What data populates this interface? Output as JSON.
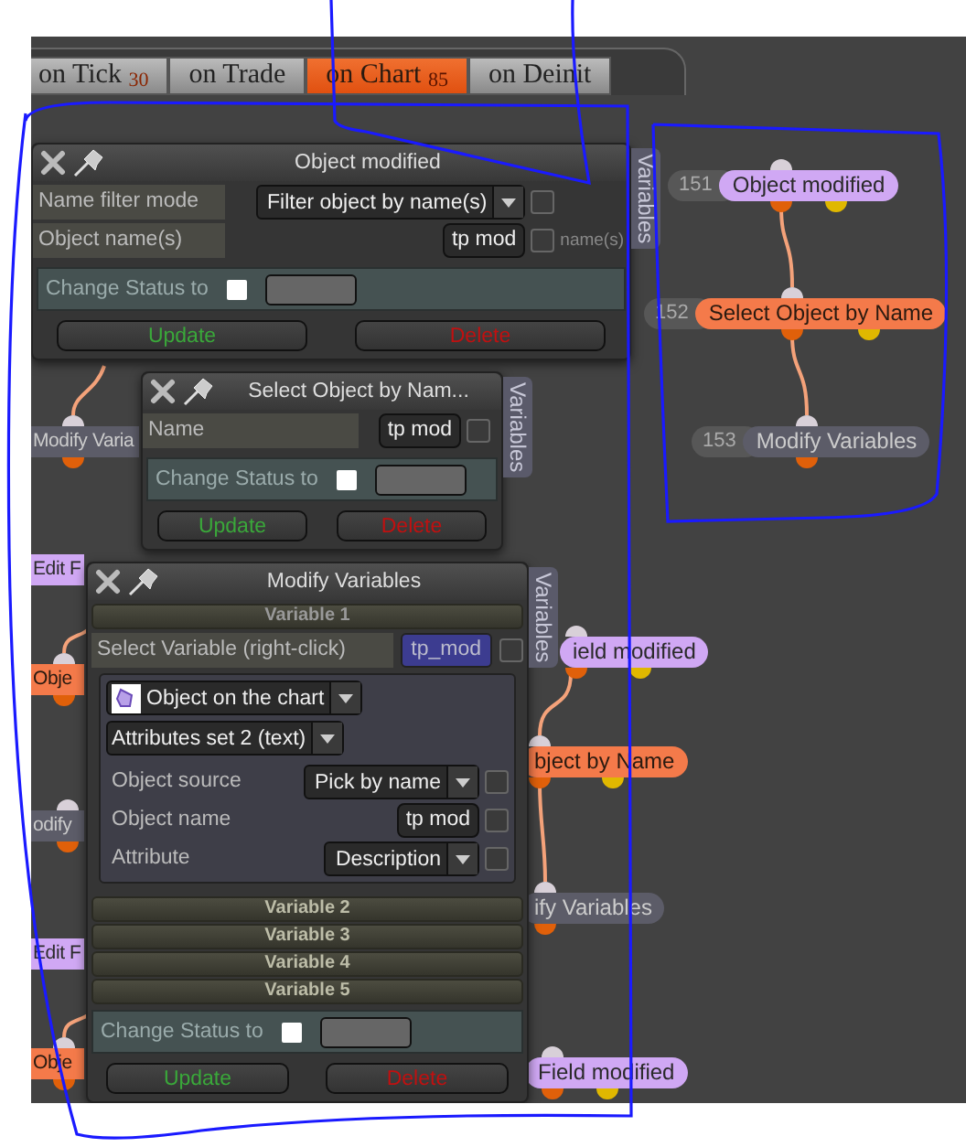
{
  "tabs": [
    {
      "label": "on Tick $_{30}$",
      "selected": false
    },
    {
      "label": "on Trade",
      "selected": false
    },
    {
      "label": "on Chart $_{85}$",
      "selected": true
    },
    {
      "label": "on Deinit",
      "selected": false
    }
  ],
  "graph_nodes": [
    {
      "number": "151",
      "label": "Object modified",
      "kind": "event"
    },
    {
      "number": "152",
      "label": "Select Object by Name",
      "kind": "filter"
    },
    {
      "number": "153",
      "label": "Modify Variables",
      "kind": "action"
    },
    {
      "label": "ield modified",
      "kind": "event"
    },
    {
      "label": "bject by Name",
      "kind": "filter"
    },
    {
      "label": "ify Variables",
      "kind": "action"
    },
    {
      "label": "Field modified",
      "kind": "event"
    },
    {
      "label": "Modify Varia",
      "kind": "action"
    },
    {
      "label": "Edit F",
      "kind": "event"
    },
    {
      "label": "Obje",
      "kind": "filter"
    },
    {
      "label": "odify",
      "kind": "action"
    },
    {
      "label": "Edit F",
      "kind": "event"
    },
    {
      "label": "Obje",
      "kind": "filter"
    }
  ],
  "panels": [
    {
      "title": "Object modified",
      "side_tab": "Variables",
      "rows": [
        {
          "kind": "dropdown",
          "label": "Name filter mode",
          "value": "Filter object by name(s)",
          "checked": false
        },
        {
          "kind": "text",
          "label": "Object name(s)",
          "value": "tp mod",
          "checked": false,
          "note": "name(s)"
        }
      ],
      "status": {
        "label": "Change Status to",
        "checked": false
      },
      "buttons": [
        {
          "label": "Update",
          "kind": "confirm"
        },
        {
          "label": "Delete",
          "kind": "danger"
        }
      ]
    },
    {
      "title": "Select Object by Nam...",
      "side_tab": "Variables",
      "rows": [
        {
          "kind": "text",
          "label": "Name",
          "value": "tp mod",
          "checked": false
        }
      ],
      "status": {
        "label": "Change Status to",
        "checked": false
      },
      "buttons": [
        {
          "label": "Update",
          "kind": "confirm"
        },
        {
          "label": "Delete",
          "kind": "danger"
        }
      ]
    },
    {
      "title": "Modify Variables",
      "side_tab": "Variables",
      "variables": [
        {
          "title": "Variable 1",
          "expanded": true,
          "select_label": "Select Variable (right-click)",
          "variable": "tp_mod",
          "checked": false,
          "source": "Object on the chart",
          "attribute_set": "Attributes set 2 (text)",
          "rows": [
            {
              "kind": "dropdown",
              "label": "Object source",
              "value": "Pick by name",
              "checked": false
            },
            {
              "kind": "text",
              "label": "Object name",
              "value": "tp mod",
              "checked": false
            },
            {
              "kind": "dropdown",
              "label": "Attribute",
              "value": "Description",
              "checked": false
            }
          ]
        },
        {
          "title": "Variable 2",
          "expanded": false
        },
        {
          "title": "Variable 3",
          "expanded": false
        },
        {
          "title": "Variable 4",
          "expanded": false
        },
        {
          "title": "Variable 5",
          "expanded": false
        }
      ],
      "status": {
        "label": "Change Status to",
        "checked": false
      },
      "buttons": [
        {
          "label": "Update",
          "kind": "confirm"
        },
        {
          "label": "Delete",
          "kind": "danger"
        }
      ]
    }
  ]
}
